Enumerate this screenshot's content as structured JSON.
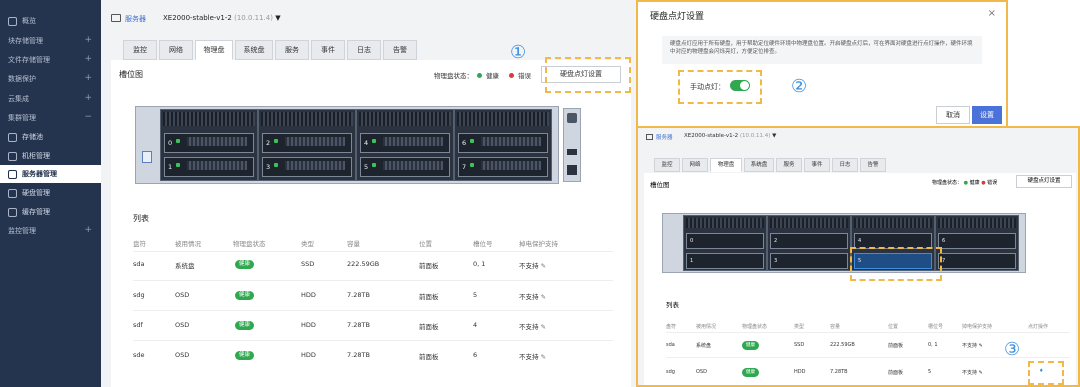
{
  "sidebar": {
    "items": [
      {
        "label": "概览",
        "plus": ""
      },
      {
        "label": "块存储管理",
        "plus": "+"
      },
      {
        "label": "文件存储管理",
        "plus": "+"
      },
      {
        "label": "数据保护",
        "plus": "+"
      },
      {
        "label": "云集成",
        "plus": "+"
      },
      {
        "label": "集群管理",
        "plus": "−"
      },
      {
        "label": "存储池",
        "plus": ""
      },
      {
        "label": "机柜管理",
        "plus": ""
      },
      {
        "label": "服务器管理",
        "plus": ""
      },
      {
        "label": "硬盘管理",
        "plus": ""
      },
      {
        "label": "缓存管理",
        "plus": ""
      },
      {
        "label": "监控管理",
        "plus": "+"
      }
    ]
  },
  "header": {
    "breadcrumb_link": "服务器",
    "server_name": "XE2000-stable-v1-2",
    "server_ip": "(10.0.11.4)"
  },
  "tabs": [
    "监控",
    "网络",
    "物理盘",
    "系统盘",
    "服务",
    "事件",
    "日志",
    "告警"
  ],
  "active_tab_index": 2,
  "slot_section": {
    "title": "槽位图",
    "status_label": "物理盘状态：",
    "healthy_label": "健康",
    "error_label": "错误",
    "led_button": "硬盘点灯设置",
    "slots_top": [
      "0",
      "2",
      "4",
      "6"
    ],
    "slots_bottom": [
      "1",
      "3",
      "5",
      "7"
    ]
  },
  "markers": {
    "one": "①",
    "two": "②",
    "three": "③"
  },
  "list": {
    "title": "列表",
    "columns": [
      "盘符",
      "被用情况",
      "物理盘状态",
      "类型",
      "容量",
      "位置",
      "槽位号",
      "掉电保护支持"
    ],
    "zoom_extra_column": "点灯操作",
    "rows": [
      {
        "disk": "sda",
        "usage": "系统盘",
        "status": "健康",
        "type": "SSD",
        "capacity": "222.59GB",
        "position": "前面板",
        "slot": "0, 1",
        "protect": "不支持"
      },
      {
        "disk": "sdg",
        "usage": "OSD",
        "status": "健康",
        "type": "HDD",
        "capacity": "7.28TB",
        "position": "前面板",
        "slot": "5",
        "protect": "不支持"
      },
      {
        "disk": "sdf",
        "usage": "OSD",
        "status": "健康",
        "type": "HDD",
        "capacity": "7.28TB",
        "position": "前面板",
        "slot": "4",
        "protect": "不支持"
      },
      {
        "disk": "sde",
        "usage": "OSD",
        "status": "健康",
        "type": "HDD",
        "capacity": "7.28TB",
        "position": "前面板",
        "slot": "6",
        "protect": "不支持"
      }
    ],
    "zoom_row1_capacity": "222.59GB"
  },
  "dialog": {
    "title": "硬盘点灯设置",
    "close": "×",
    "description": "硬盘点灯应用于所有硬盘，用于帮助定位硬件环境中物理盘位置。开启硬盘点灯后，可在界面对硬盘进行点灯操作，硬件环境中对应的物理盘会闪烁亮灯，方便定位排查。",
    "toggle_label": "手动点灯：",
    "cancel": "取消",
    "ok": "设置"
  },
  "colors": {
    "sidebar_bg": "#24344f",
    "accent": "#3a8de0",
    "highlight": "#f0b94a",
    "healthy": "#2fa84f",
    "error": "#d93b3b"
  }
}
